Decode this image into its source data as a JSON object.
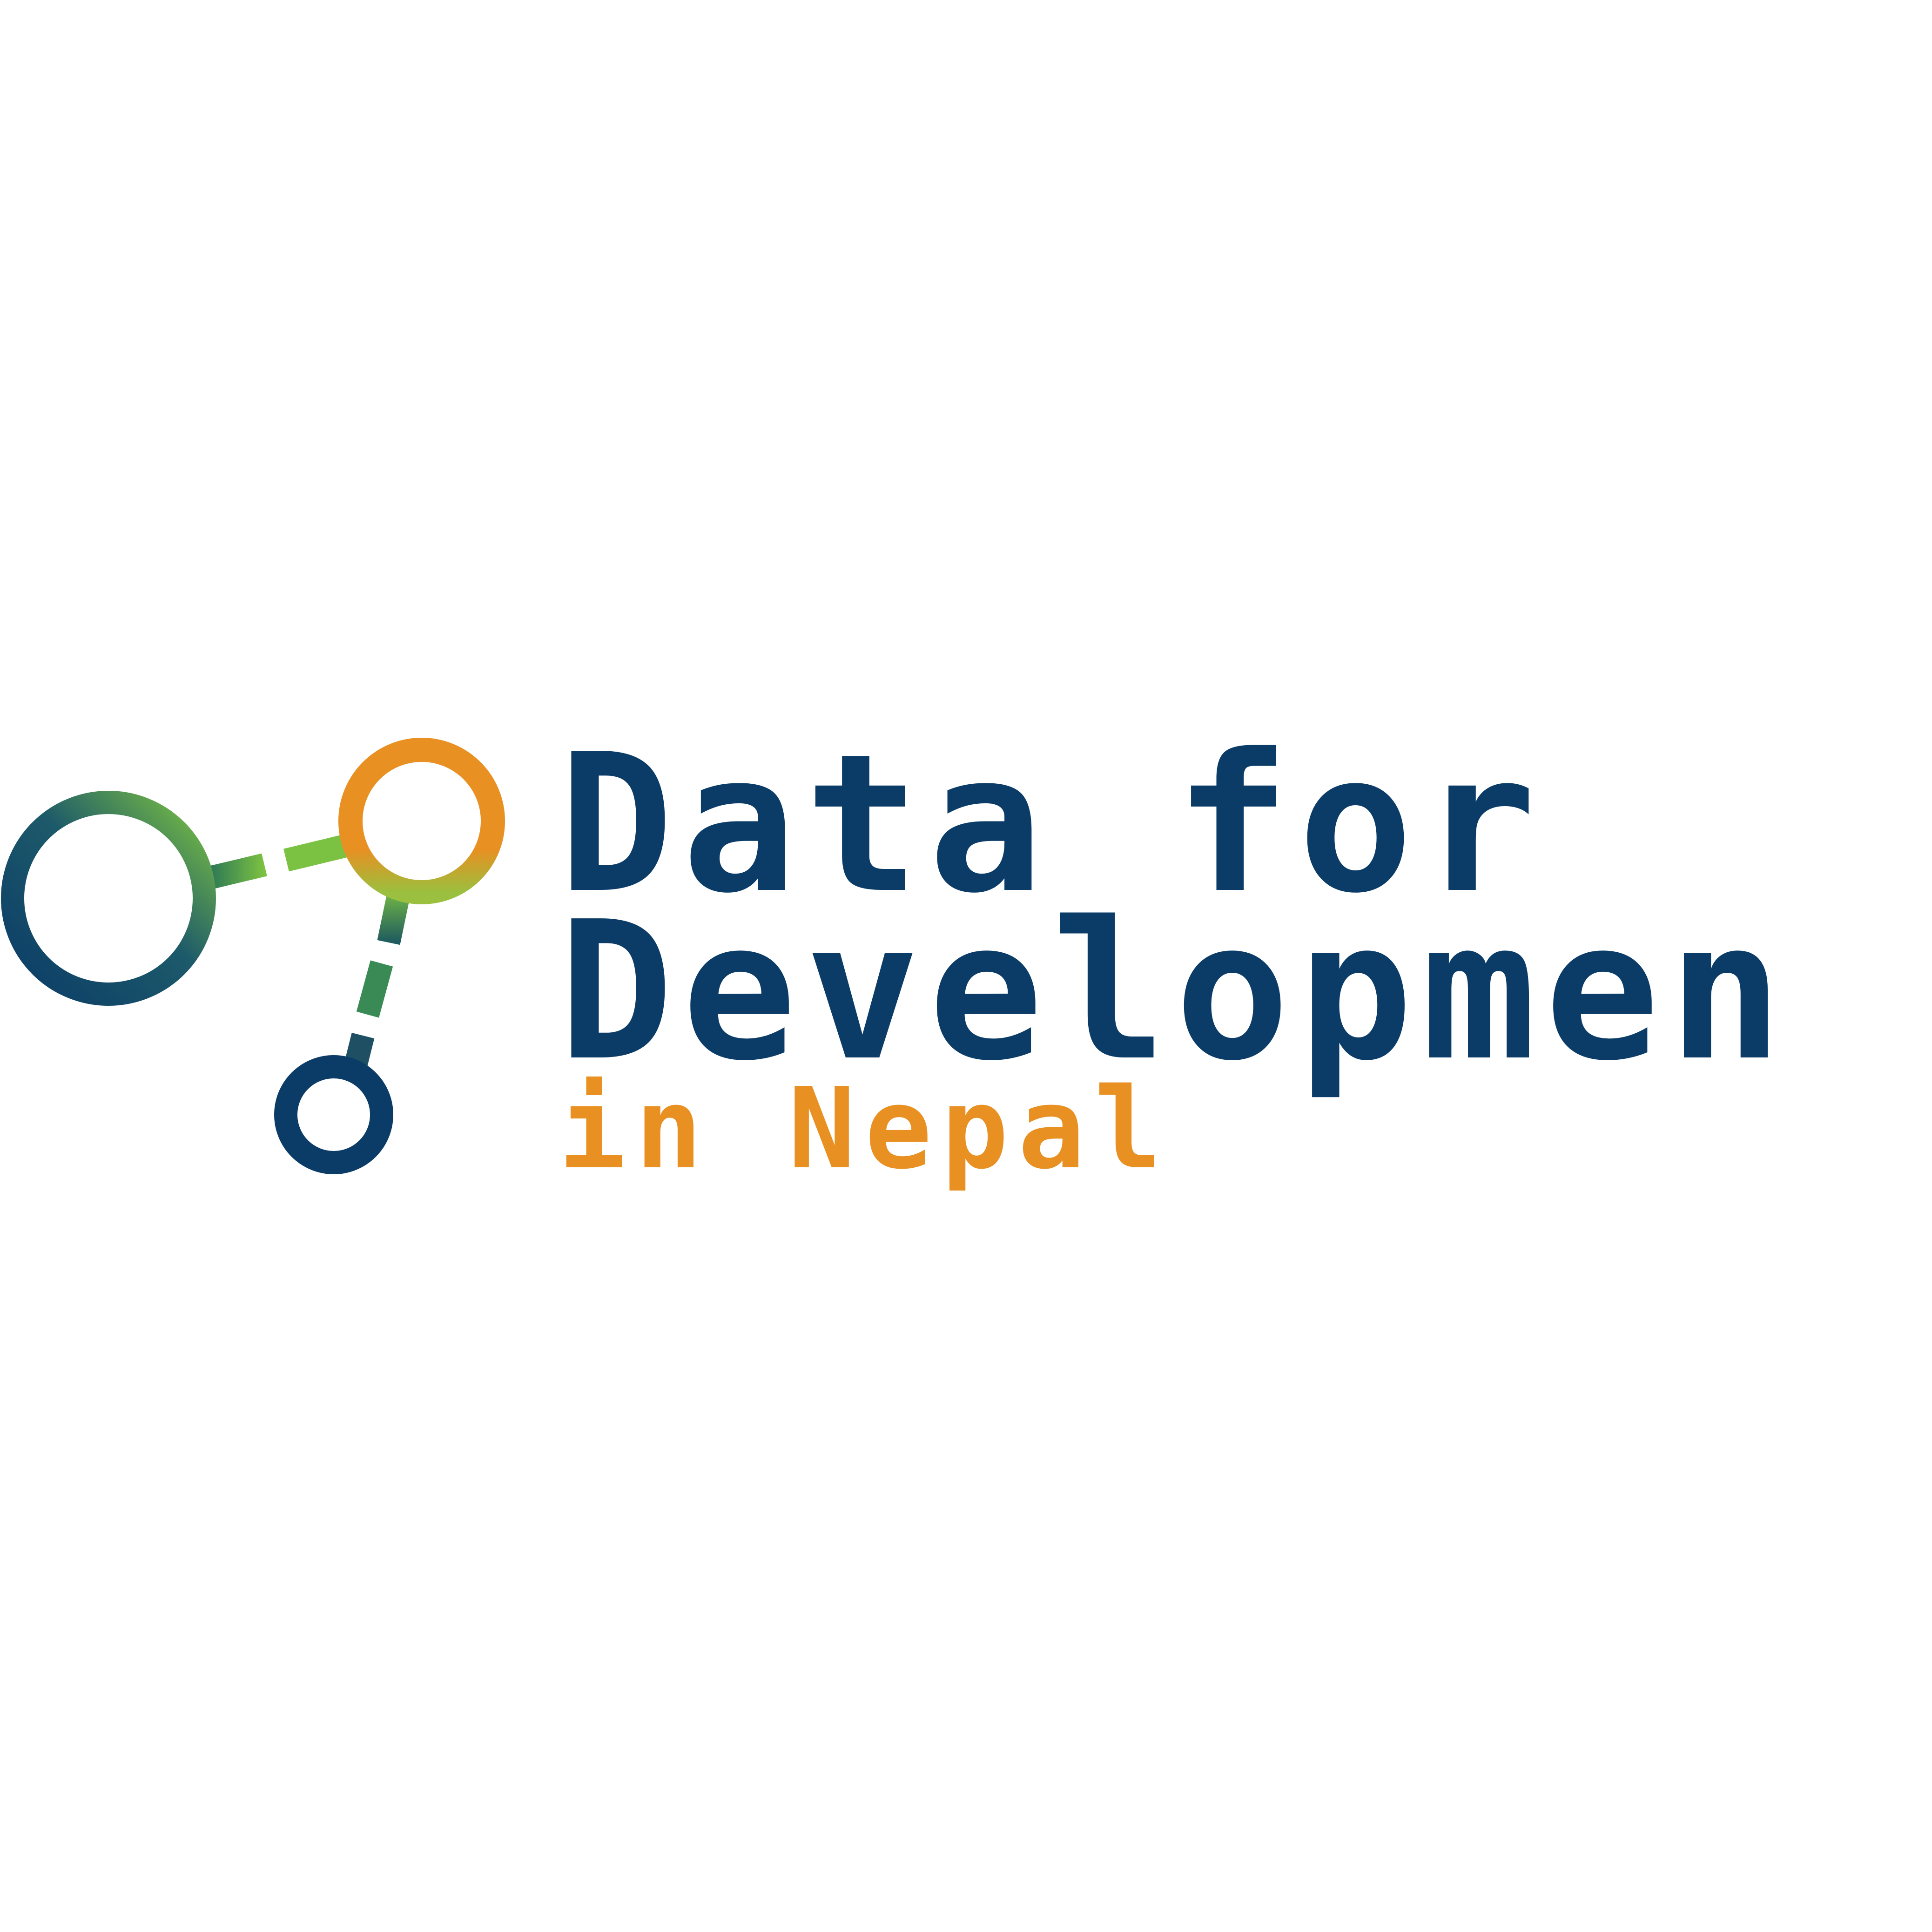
{
  "brand": {
    "line1": "Data for",
    "line2": "Developmen",
    "line3": "in Nepal",
    "colors": {
      "navy": "#0b3c67",
      "orange": "#e89022",
      "green": "#7cc242",
      "background": "#ffffff"
    }
  },
  "icons": {
    "large_node": "ring-icon",
    "top_node": "ring-icon",
    "bottom_node": "ring-icon",
    "connectors": "dashed-link-icon"
  }
}
